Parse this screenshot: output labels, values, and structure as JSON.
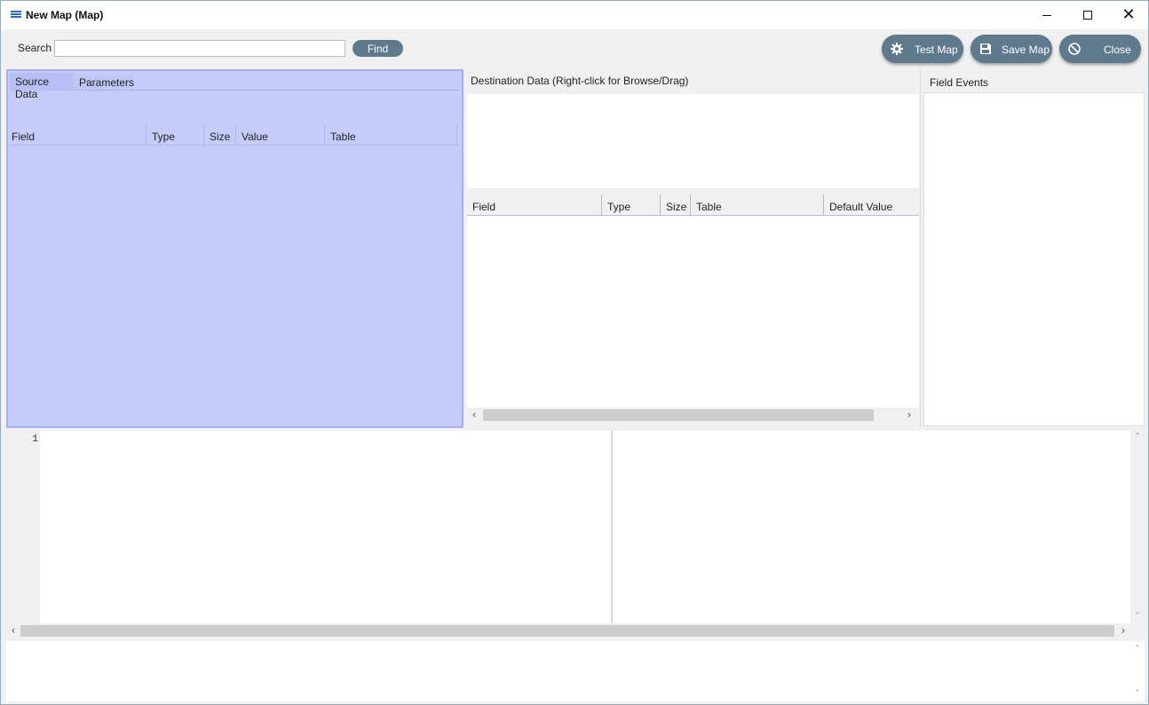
{
  "window": {
    "title": "New Map (Map)"
  },
  "toolbar": {
    "search_label": "Search",
    "search_value": "",
    "find_label": "Find",
    "test_map_label": "Test Map",
    "save_map_label": "Save Map",
    "close_label": "Close"
  },
  "source": {
    "tabs": [
      "Source Data",
      "Parameters"
    ],
    "columns": [
      "Field",
      "Type",
      "Size",
      "Value",
      "Table"
    ]
  },
  "destination": {
    "title": "Destination Data   (Right-click for Browse/Drag)",
    "columns": [
      "Field",
      "Type",
      "Size",
      "Table",
      "Default Value"
    ]
  },
  "events": {
    "title": "Field Events"
  },
  "editor": {
    "line_numbers": [
      "1"
    ]
  },
  "colors": {
    "accent_button": "#5f7a8c",
    "source_selection": "#c6ccf9",
    "title_icon": "#2c6fbf"
  }
}
